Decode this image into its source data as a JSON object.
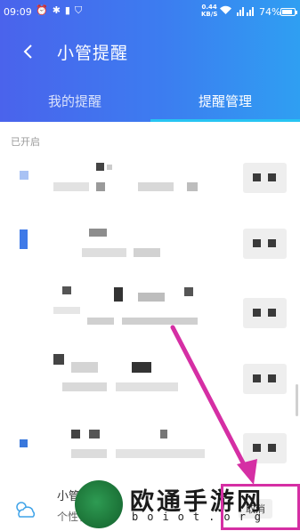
{
  "status_bar": {
    "time": "09:09",
    "net_speed_value": "0.44",
    "net_speed_unit": "KB/S",
    "battery": "74%",
    "battery_level": 0.74
  },
  "header": {
    "title": "小管提醒",
    "tabs": [
      {
        "label": "我的提醒",
        "active": false
      },
      {
        "label": "提醒管理",
        "active": true
      }
    ]
  },
  "section": {
    "label": "已开启"
  },
  "reminders": [
    {
      "icon_color": "#a9c2f4"
    },
    {
      "icon_color": "#3f7ae8"
    },
    {
      "icon_color": "#ffffff"
    },
    {
      "icon_color": "#ffffff"
    },
    {
      "icon_color": "#3a78dc"
    }
  ],
  "bottom_item": {
    "title": "小管",
    "subtitle": "个性化",
    "cancel_label": "取消"
  },
  "watermark": {
    "text": "欧通手游网",
    "url": "boiot.org"
  },
  "colors": {
    "header_gradient_start": "#4a63ec",
    "header_gradient_end": "#2f9ff2",
    "tab_indicator": "#27c4f2",
    "annotation": "#d52fa4"
  }
}
